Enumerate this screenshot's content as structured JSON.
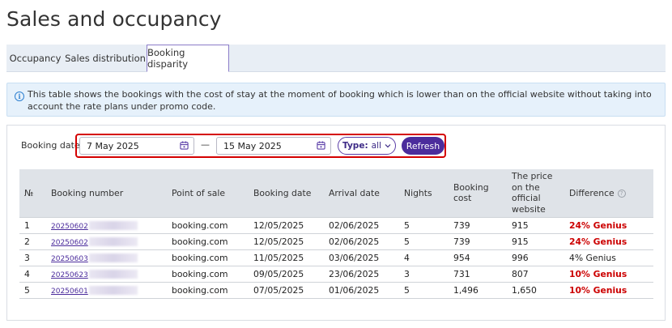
{
  "page_title": "Sales and occupancy",
  "tabs": [
    {
      "label": "Occupancy",
      "active": false
    },
    {
      "label": "Sales distribution",
      "active": false
    },
    {
      "label": "Booking disparity",
      "active": true
    }
  ],
  "info": {
    "icon": "info-icon",
    "text": "This table shows the bookings with the cost of stay at the moment of booking which is lower than on the official website without taking into account the rate plans under promo code."
  },
  "filters": {
    "label": "Booking dates",
    "date_from": "7 May 2025",
    "separator": "—",
    "date_to": "15 May 2025",
    "type_label": "Type:",
    "type_value": "all",
    "refresh_label": "Refresh"
  },
  "table": {
    "headers": {
      "num": "№",
      "booking_number": "Booking number",
      "point_of_sale": "Point of sale",
      "booking_date": "Booking date",
      "arrival_date": "Arrival date",
      "nights": "Nights",
      "booking_cost": "Booking cost",
      "official_price": "The price on the official website",
      "difference": "Difference"
    },
    "rows": [
      {
        "num": "1",
        "booking_number": "20250602",
        "point_of_sale": "booking.com",
        "booking_date": "12/05/2025",
        "arrival_date": "02/06/2025",
        "nights": "5",
        "booking_cost": "739",
        "official_price": "915",
        "difference": "24%  Genius",
        "highlight": true
      },
      {
        "num": "2",
        "booking_number": "20250602",
        "point_of_sale": "booking.com",
        "booking_date": "12/05/2025",
        "arrival_date": "02/06/2025",
        "nights": "5",
        "booking_cost": "739",
        "official_price": "915",
        "difference": "24%  Genius",
        "highlight": true
      },
      {
        "num": "3",
        "booking_number": "20250603",
        "point_of_sale": "booking.com",
        "booking_date": "11/05/2025",
        "arrival_date": "03/06/2025",
        "nights": "4",
        "booking_cost": "954",
        "official_price": "996",
        "difference": "4%  Genius",
        "highlight": false
      },
      {
        "num": "4",
        "booking_number": "20250623",
        "point_of_sale": "booking.com",
        "booking_date": "09/05/2025",
        "arrival_date": "23/06/2025",
        "nights": "3",
        "booking_cost": "731",
        "official_price": "807",
        "difference": "10%  Genius",
        "highlight": true
      },
      {
        "num": "5",
        "booking_number": "20250601",
        "point_of_sale": "booking.com",
        "booking_date": "07/05/2025",
        "arrival_date": "01/06/2025",
        "nights": "5",
        "booking_cost": "1,496",
        "official_price": "1,650",
        "difference": "10%  Genius",
        "highlight": true
      }
    ]
  },
  "colors": {
    "accent": "#4b2c9c",
    "highlight_red": "#d40000",
    "difference_red": "#cc0000"
  }
}
